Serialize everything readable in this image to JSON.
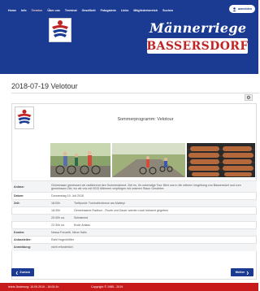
{
  "nav": {
    "items": [
      "Home",
      "Info",
      "Termine",
      "Über uns",
      "Terminal",
      "Gesellkeit",
      "Fotogalerie",
      "Links",
      "Mitgliederbereich",
      "Suchen"
    ],
    "login_label": "anmelden"
  },
  "brand": {
    "title": "Männerriege",
    "subtitle": "BASSERSDORF"
  },
  "page_title": "2018-07-19 Velotour",
  "event": {
    "heading": "Sommerprogramm: Velotour",
    "rows": [
      {
        "label": "Anlass:",
        "value": "Gemeinsam geniessen wir radfahrend den Sommerabend. Ziel es, Ihr unkendige Tour fährt uns in die nähere Umgebung von Bassersdorf und zum gemeinsam Ziel, wo wir uns mit 0033 Männern verpflegen mit unseren Staun Gesichter."
      },
      {
        "label": "Datum:",
        "value": "Donnerstag 19. Juli 2018"
      },
      {
        "label": "Zeit:",
        "time": "18:00h",
        "value": "Treffpunkt: Turnhallenforum am Mattepl"
      },
      {
        "label": "",
        "time": "18:30h",
        "value": "Gemeinsame Radtour - Route und Dauer werden noch bekannt gegeben"
      },
      {
        "label": "",
        "time": "20:30h ca.",
        "value": "Schlaternd"
      },
      {
        "label": "",
        "time": "22:30h ca.",
        "value": "Ende Anlass"
      },
      {
        "label": "Kosten:",
        "value": "Nessa Fonzetti, Neue Hallo"
      },
      {
        "label": "Anlassleiter:",
        "value": "Rahl Hugenhöfler"
      },
      {
        "label": "Anmeldung:",
        "value": "nicht erforderlich"
      }
    ]
  },
  "buttons": {
    "back": "Zurück",
    "next": "Weiter"
  },
  "footer": {
    "updated": "letzte Änderung: 15.09.2019 - 18:00:1h",
    "copyright": "Copyright © 1985 - 2019"
  }
}
